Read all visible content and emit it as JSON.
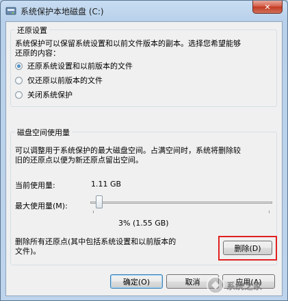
{
  "window": {
    "title": "系统保护本地磁盘 (C:)",
    "close_glyph": "✕"
  },
  "restore": {
    "group_title": "还原设置",
    "description_line1": "系统保护可以保留系统设置和以前文件版本的副本。选择您希望能够",
    "description_line2": "还原的内容：",
    "options": [
      {
        "label": "还原系统设置和以前版本的文件",
        "checked": true
      },
      {
        "label": "仅还原以前版本的文件",
        "checked": false
      },
      {
        "label": "关闭系统保护",
        "checked": false
      }
    ]
  },
  "disk": {
    "group_title": "磁盘空间使用量",
    "description_line1": "可以调整用于系统保护的最大磁盘空间。占满空间时，系统将删除较",
    "description_line2": "旧的还原点以便为新还原点留出空间。",
    "current_label": "当前使用量:",
    "current_value": "1.11 GB",
    "max_label": "最大使用量(M):",
    "slider_fraction": 0.03,
    "slider_value_text": "3% (1.55 GB)",
    "delete_text_line1": "删除所有还原点(其中包括系统设置和以前版本的",
    "delete_text_line2": "文件)。",
    "delete_button": "删除(D)"
  },
  "footer": {
    "ok_button": "确定(O)",
    "cancel_button": "取消",
    "apply_button": "应用(A)"
  },
  "watermark": {
    "text": "系统之家"
  },
  "colors": {
    "highlight": "#e02020",
    "client_bg": "#f0f0f0",
    "frame": "#bcd2ea"
  }
}
